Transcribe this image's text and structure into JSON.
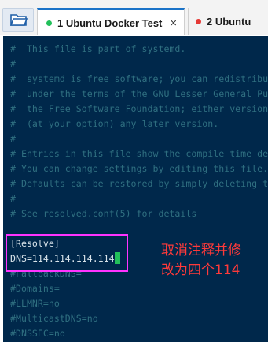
{
  "tabs": [
    {
      "number_label": "1 Ubuntu Docker Test",
      "dot_color": "#22c05a",
      "active": true,
      "close_label": "×"
    },
    {
      "number_label": "2 Ubuntu",
      "dot_color": "#e53935",
      "active": false
    }
  ],
  "terminal": {
    "lines": [
      "#  This file is part of systemd.",
      "#",
      "#  systemd is free software; you can redistribu",
      "#  under the terms of the GNU Lesser General Pu",
      "#  the Free Software Foundation; either version",
      "#  (at your option) any later version.",
      "#",
      "# Entries in this file show the compile time de",
      "# You can change settings by editing this file.",
      "# Defaults can be restored by simply deleting t",
      "#",
      "# See resolved.conf(5) for details",
      "",
      "[Resolve]",
      "DNS=114.114.114.114",
      "#FallbackDNS=",
      "#Domains=",
      "#LLMNR=no",
      "#MulticastDNS=no",
      "#DNSSEC=no"
    ]
  },
  "annotation": {
    "line1": "取消注释并修",
    "line2": "改为四个114",
    "color": "#ff3a3a"
  },
  "colors": {
    "terminal_bg": "#00284b",
    "comment": "#2f6f80",
    "text": "#d8e3ea",
    "cursor": "#22c05a",
    "highlight_box": "#ff33ff",
    "tab_accent": "#1a73c8"
  }
}
